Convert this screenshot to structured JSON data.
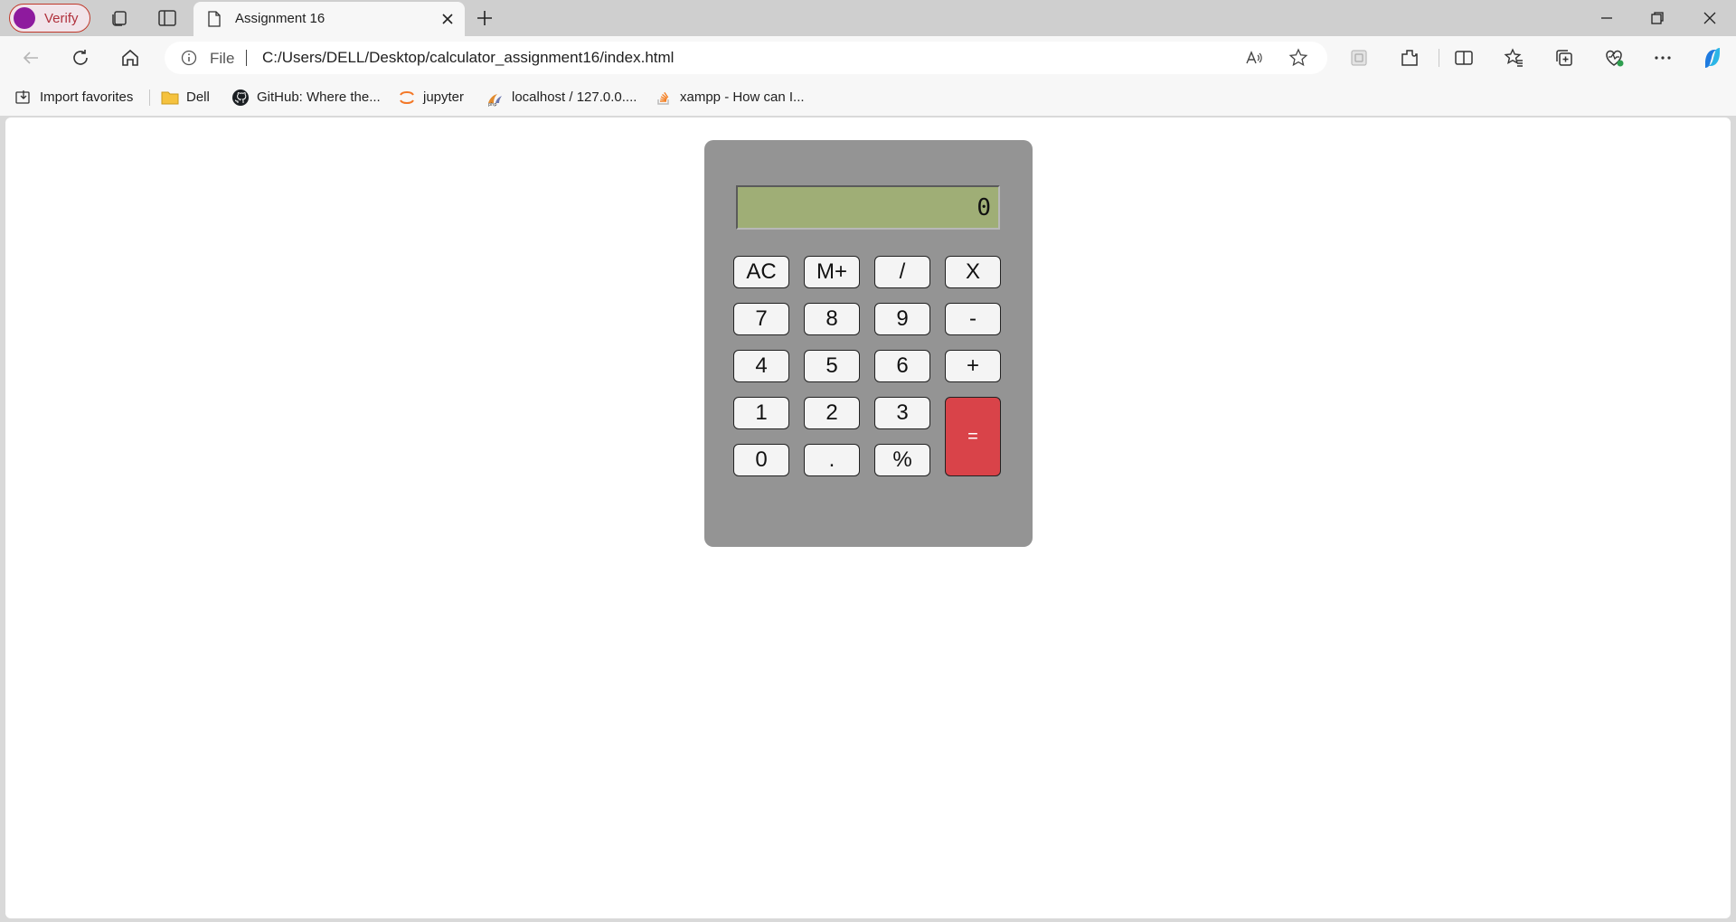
{
  "browser": {
    "profile_label": "Verify",
    "tab_title": "Assignment 16",
    "address": {
      "scheme_label": "File",
      "url": "C:/Users/DELL/Desktop/calculator_assignment16/index.html"
    },
    "favorites": [
      {
        "label": "Import favorites",
        "icon": "import-icon"
      },
      {
        "label": "Dell",
        "icon": "folder-icon"
      },
      {
        "label": "GitHub: Where the...",
        "icon": "github-icon"
      },
      {
        "label": "jupyter",
        "icon": "jupyter-icon"
      },
      {
        "label": "localhost / 127.0.0....",
        "icon": "phpmyadmin-icon"
      },
      {
        "label": "xampp - How can I...",
        "icon": "stackoverflow-icon"
      }
    ]
  },
  "calculator": {
    "display_value": "0",
    "keys": {
      "ac": "AC",
      "mplus": "M+",
      "divide": "/",
      "multiply": "X",
      "seven": "7",
      "eight": "8",
      "nine": "9",
      "minus": "-",
      "four": "4",
      "five": "5",
      "six": "6",
      "plus": "+",
      "one": "1",
      "two": "2",
      "three": "3",
      "equals": "=",
      "zero": "0",
      "dot": ".",
      "percent": "%"
    },
    "colors": {
      "body": "#949494",
      "display": "#9fae76",
      "equals": "#d94349"
    }
  }
}
